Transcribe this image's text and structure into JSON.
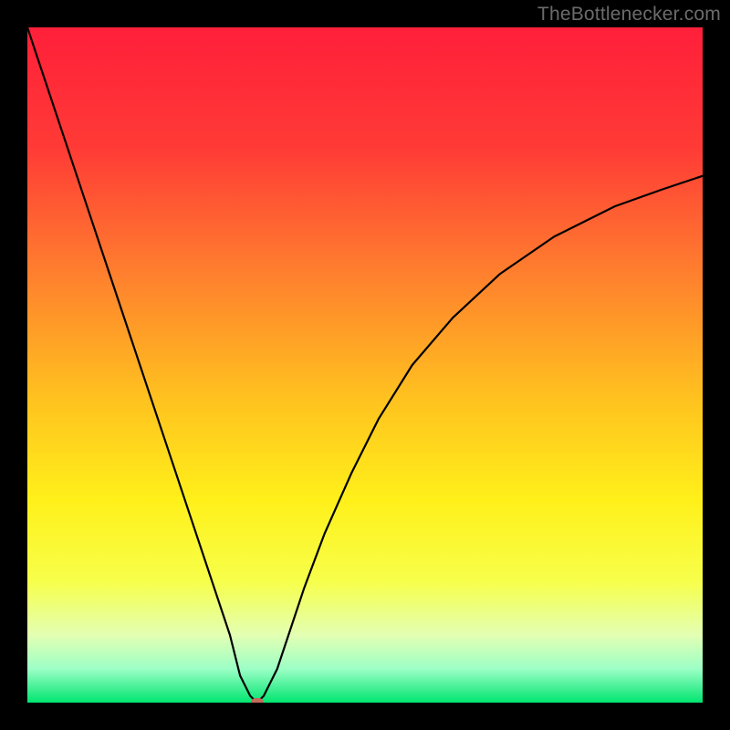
{
  "watermark": "TheBottlenecker.com",
  "colors": {
    "marker": "#c46a5d",
    "curve": "#000000",
    "bg_black": "#000000",
    "gradient_stops": [
      {
        "pct": 0,
        "color": "#ff1f3a"
      },
      {
        "pct": 18,
        "color": "#ff3b36"
      },
      {
        "pct": 35,
        "color": "#ff7a2f"
      },
      {
        "pct": 55,
        "color": "#ffc21f"
      },
      {
        "pct": 70,
        "color": "#fff01a"
      },
      {
        "pct": 82,
        "color": "#f7ff4a"
      },
      {
        "pct": 90,
        "color": "#e3ffb3"
      },
      {
        "pct": 95,
        "color": "#9cffc6"
      },
      {
        "pct": 100,
        "color": "#00e56f"
      }
    ]
  },
  "chart_data": {
    "type": "line",
    "title": "",
    "xlabel": "",
    "ylabel": "",
    "xlim": [
      0,
      100
    ],
    "ylim": [
      0,
      100
    ],
    "series": [
      {
        "name": "bottleneck-curve",
        "x": [
          0,
          3,
          6,
          9,
          12,
          15,
          18,
          21,
          24,
          27,
          30,
          31.5,
          33,
          34,
          35,
          37,
          39,
          41,
          44,
          48,
          52,
          57,
          63,
          70,
          78,
          87,
          94,
          100
        ],
        "values": [
          100,
          91,
          82,
          73,
          64,
          55,
          46,
          37,
          28,
          19,
          10,
          4,
          1,
          0,
          1,
          5,
          11,
          17,
          25,
          34,
          42,
          50,
          57,
          63.5,
          69,
          73.5,
          76,
          78
        ]
      }
    ],
    "marker": {
      "x": 34,
      "y": 0
    },
    "legend": false,
    "grid": false
  }
}
